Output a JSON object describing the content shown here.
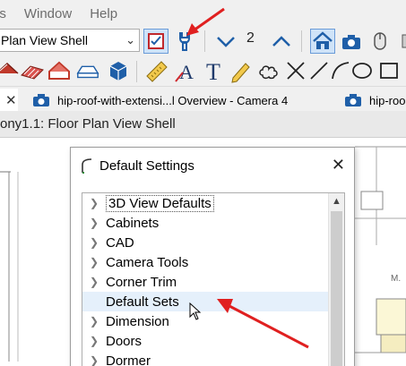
{
  "menu": {
    "items": [
      "Window",
      "Help"
    ],
    "cut_item": "ls"
  },
  "toolbar": {
    "view_select_value": "Plan View Shell",
    "floor_number": "2"
  },
  "tabs": [
    {
      "label": "hip-roof-with-extensi...l Overview - Camera 4"
    },
    {
      "label": "hip-roo"
    }
  ],
  "view_title": "ony1.1: Floor Plan View Shell",
  "dialog": {
    "title": "Default Settings",
    "items": [
      "3D View Defaults",
      "Cabinets",
      "CAD",
      "Camera Tools",
      "Corner Trim",
      "Default Sets",
      "Dimension",
      "Doors",
      "Dormer"
    ]
  },
  "canvas_label": "M.",
  "colors": {
    "accent_red": "#e02020",
    "toolbar_blue": "#1f5fa8",
    "selected_row": "#e5f0fb"
  }
}
